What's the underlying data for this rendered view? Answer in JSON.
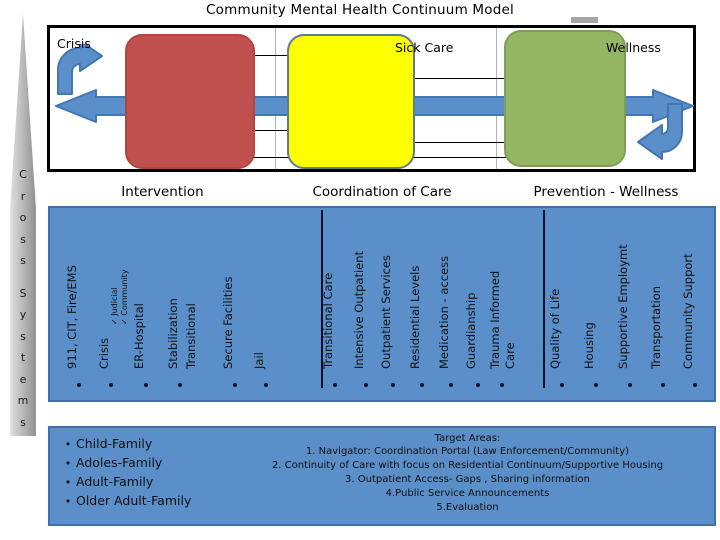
{
  "title": "Community Mental Health Continuum Model",
  "cone": {
    "label_chars": [
      "C",
      "r",
      "o",
      "s",
      "s",
      "",
      "S",
      "y",
      "s",
      "t",
      "e",
      "m",
      "s"
    ],
    "label_text": "Cross Systems"
  },
  "continuum": {
    "stage_labels": {
      "crisis": "Crisis",
      "sick_care": "Sick Care",
      "wellness": "Wellness"
    },
    "boxes": [
      {
        "name": "crisis-box",
        "color": "#C0504D"
      },
      {
        "name": "sick-care-box",
        "color": "#FFFF00"
      },
      {
        "name": "wellness-box",
        "color": "#94B663"
      }
    ],
    "arrow_color": "#5B8FC9"
  },
  "sections": [
    {
      "header": "Intervention"
    },
    {
      "header": "Coordination of Care"
    },
    {
      "header": "Prevention - Wellness"
    }
  ],
  "services": {
    "intervention": [
      {
        "label": "911, CIT, Fire/EMS",
        "sub": []
      },
      {
        "label": "Crisis",
        "sub": [
          "Judicial",
          "Community"
        ]
      },
      {
        "label": "ER-Hospital",
        "sub": []
      },
      {
        "label": "Stabilization",
        "sub": []
      },
      {
        "label": "Transitional",
        "sub": []
      },
      {
        "label": "Secure Facilities",
        "sub": []
      },
      {
        "label": "Jail",
        "sub": []
      }
    ],
    "coordination": [
      {
        "label": "Transitional Care"
      },
      {
        "label": "Intensive Outpatient"
      },
      {
        "label": "Outpatient Services"
      },
      {
        "label": "Residential Levels"
      },
      {
        "label": "Medication - access"
      },
      {
        "label": "Guardianship"
      },
      {
        "label": "Trauma Informed Care",
        "line1": "Trauma Informed",
        "line2": "Care"
      }
    ],
    "prevention": [
      {
        "label": "Quality of Life"
      },
      {
        "label": "Housing"
      },
      {
        "label": "Supportive Employmt"
      },
      {
        "label": "Transportation"
      },
      {
        "label": "Community Support"
      }
    ]
  },
  "targets": {
    "populations": [
      "Child-Family",
      "Adoles-Family",
      "Adult-Family",
      "Older Adult-Family"
    ],
    "bullet_glyph": "•",
    "heading": "Target Areas:",
    "items": [
      "1. Navigator: Coordination Portal (Law Enforcement/Community)",
      "2. Continuity of Care with focus on Residential Continuum/Supportive Housing",
      "3. Outpatient Access- Gaps , Sharing information",
      "4.Public Service Announcements",
      "5.Evaluation"
    ]
  },
  "colors": {
    "panel_blue": "#5B8FC9",
    "panel_blue_border": "#3F6EA8",
    "red": "#C0504D",
    "yellow": "#FFFF00",
    "green": "#94B663",
    "frame_black": "#000000"
  }
}
